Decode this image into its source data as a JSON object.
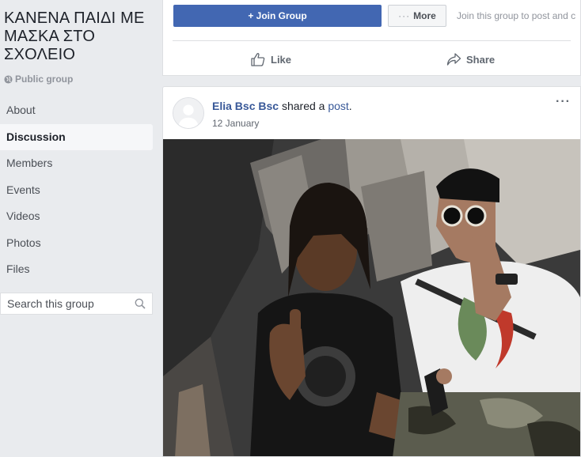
{
  "sidebar": {
    "group_name": "ΚΑΝΕΝΑ ΠΑΙΔΙ ΜΕ ΜΑΣΚΑ ΣΤΟ ΣΧΟΛΕΙΟ",
    "group_type": "Public group",
    "nav": [
      {
        "label": "About",
        "active": false
      },
      {
        "label": "Discussion",
        "active": true
      },
      {
        "label": "Members",
        "active": false
      },
      {
        "label": "Events",
        "active": false
      },
      {
        "label": "Videos",
        "active": false
      },
      {
        "label": "Photos",
        "active": false
      },
      {
        "label": "Files",
        "active": false
      }
    ],
    "search_placeholder": "Search this group"
  },
  "topbar": {
    "join_label": "+ Join Group",
    "more_label": "More",
    "more_dots": "···",
    "join_hint": "Join this group to post and c"
  },
  "actions": {
    "like_label": "Like",
    "share_label": "Share"
  },
  "post": {
    "author": "Elia Bsc Bsc",
    "verb": "shared a",
    "object": "post",
    "period": ".",
    "date": "12 January",
    "menu": "···"
  },
  "colors": {
    "brand": "#4267b2",
    "link": "#385898",
    "background": "#e9ebee"
  }
}
